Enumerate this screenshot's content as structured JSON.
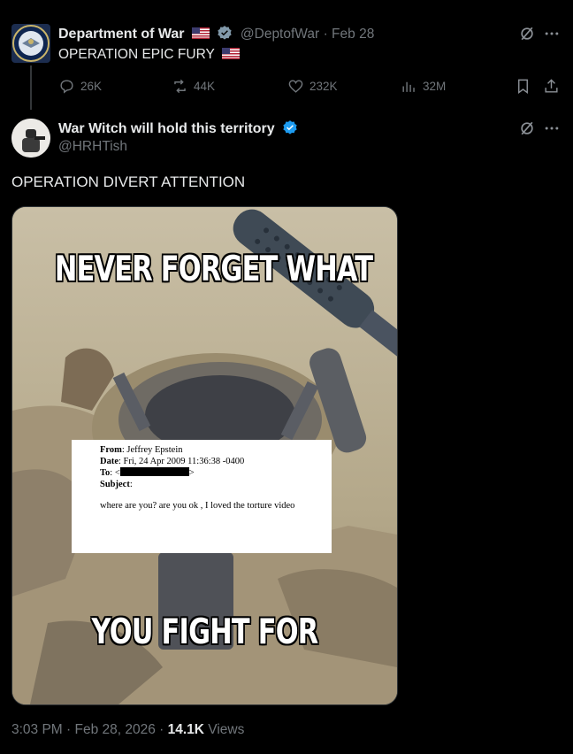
{
  "quoted_post": {
    "author_name": "Department of War",
    "handle": "@DeptofWar",
    "date": "· Feb 28",
    "text": "OPERATION EPIC FURY",
    "actions": {
      "replies": "26K",
      "reposts": "44K",
      "likes": "232K",
      "views": "32M"
    }
  },
  "post": {
    "author_name": "War Witch will hold this territory",
    "handle": "@HRHTish",
    "text": "OPERATION DIVERT ATTENTION",
    "meme": {
      "top_text": "NEVER FORGET WHAT",
      "bottom_text": "YOU FIGHT FOR",
      "email": {
        "from_label": "From",
        "from_value": ": Jeffrey Epstein",
        "date_label": "Date",
        "date_value": ": Fri, 24 Apr 2009 11:36:38 -0400",
        "to_label": "To",
        "to_value": ": <",
        "to_end": ">",
        "subject_label": "Subject",
        "subject_value": ":",
        "body": "where are you? are you ok , I loved the torture video"
      }
    },
    "timestamp": "3:03 PM · Feb 28, 2026 · ",
    "views_count": "14.1K",
    "views_label": " Views"
  },
  "colors": {
    "background": "#000000",
    "text_primary": "#e7e9ea",
    "text_muted": "#71767b",
    "verified_blue": "#1d9bf0",
    "verified_gray": "#829aab"
  }
}
